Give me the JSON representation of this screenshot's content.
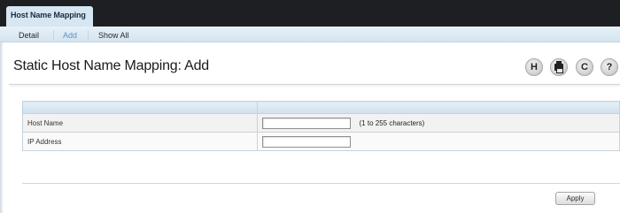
{
  "header": {
    "active_tab": "Host Name Mapping"
  },
  "subnav": {
    "items": [
      {
        "label": "Detail",
        "active": false
      },
      {
        "label": "Add",
        "active": true
      },
      {
        "label": "Show All",
        "active": false
      }
    ]
  },
  "page": {
    "title": "Static Host Name Mapping: Add"
  },
  "toolbar": {
    "icons": [
      {
        "name": "save-icon",
        "glyph": "H"
      },
      {
        "name": "print-icon",
        "glyph": ""
      },
      {
        "name": "refresh-icon",
        "glyph": "C"
      },
      {
        "name": "help-icon",
        "glyph": "?"
      }
    ]
  },
  "form": {
    "rows": [
      {
        "label": "Host Name",
        "value": "",
        "hint": "(1 to 255 characters)"
      },
      {
        "label": "IP Address",
        "value": "",
        "hint": ""
      }
    ]
  },
  "actions": {
    "apply_label": "Apply"
  },
  "colors": {
    "topbar": "#1e1f23",
    "tab_active": "#d6e6f2",
    "subnav_active_link": "#5b93c4"
  }
}
